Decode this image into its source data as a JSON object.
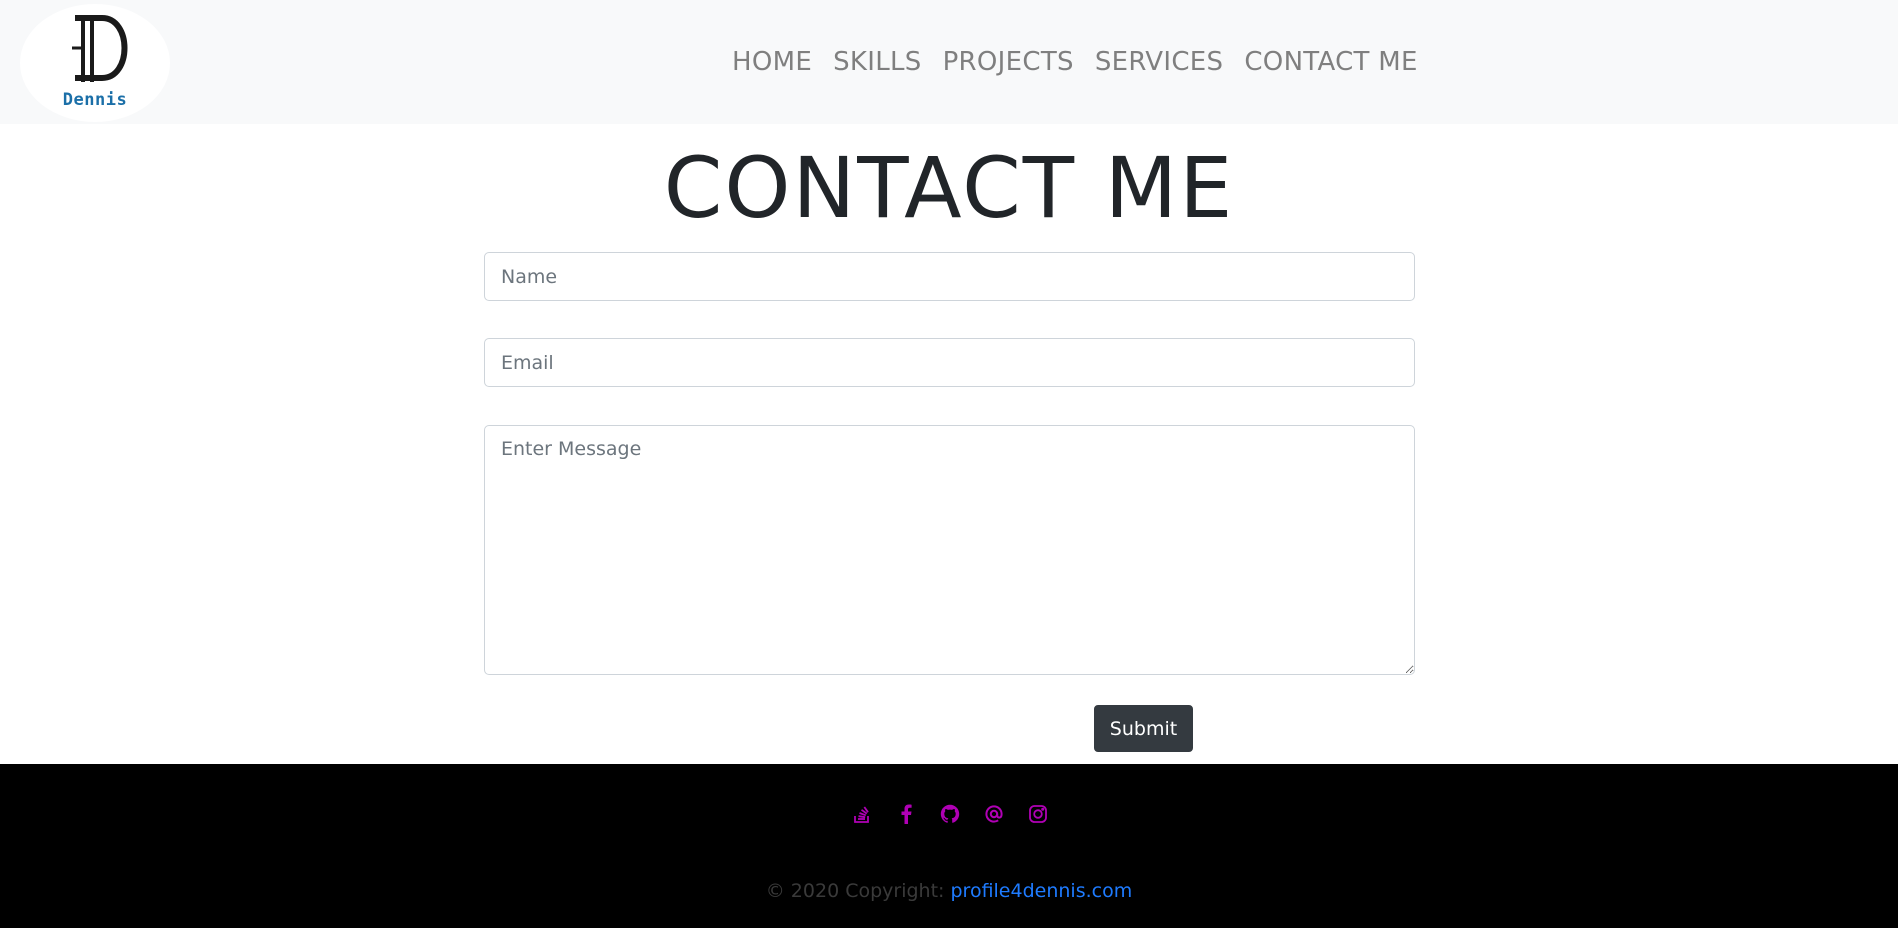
{
  "logo": {
    "name": "Dennis"
  },
  "nav": {
    "items": [
      "HOME",
      "SKILLS",
      "PROJECTS",
      "SERVICES",
      "CONTACT ME"
    ]
  },
  "main": {
    "title": "CONTACT ME",
    "form": {
      "name_placeholder": "Name",
      "email_placeholder": "Email",
      "message_placeholder": "Enter Message",
      "submit_label": "Submit"
    }
  },
  "footer": {
    "social_icons": [
      "stack-overflow-icon",
      "facebook-icon",
      "github-icon",
      "email-at-icon",
      "instagram-icon"
    ],
    "social_color": "#b000b5",
    "copyright_prefix": "© 2020 Copyright: ",
    "copyright_link": "profile4dennis.com",
    "link_color": "#1e7bff"
  }
}
